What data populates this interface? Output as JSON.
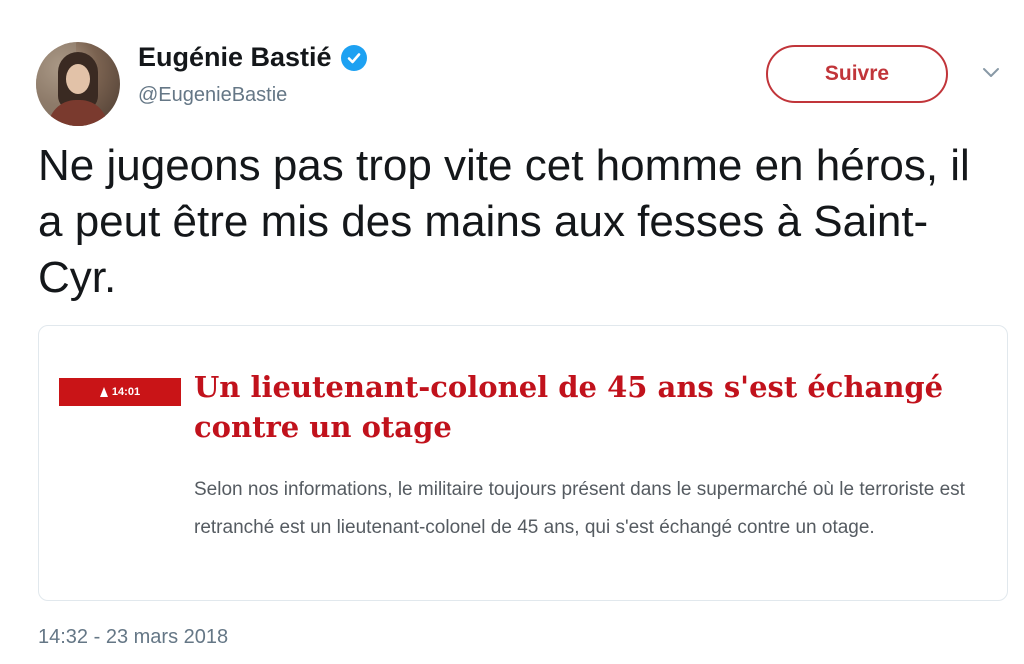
{
  "user": {
    "display_name": "Eugénie Bastié",
    "handle": "@EugenieBastie",
    "verified_icon": "verified-badge-icon",
    "avatar_icon": "profile-photo"
  },
  "follow_button": {
    "label": "Suivre",
    "color": "#c1353a"
  },
  "more_menu_icon": "chevron-down-icon",
  "tweet": {
    "text": "Ne jugeons pas trop vite cet homme en héros, il a peut être mis des mains aux fesses à Saint-Cyr."
  },
  "card": {
    "time_badge": "14:01",
    "time_badge_color": "#c91417",
    "title": "Un lieutenant-colonel de 45 ans s'est échangé contre un otage",
    "title_color": "#c1121c",
    "description": "Selon nos informations, le militaire toujours présent dans le supermarché où le terroriste est retranché est un lieutenant-colonel de 45 ans, qui s'est échangé contre un otage."
  },
  "timestamp": "14:32 - 23 mars 2018"
}
